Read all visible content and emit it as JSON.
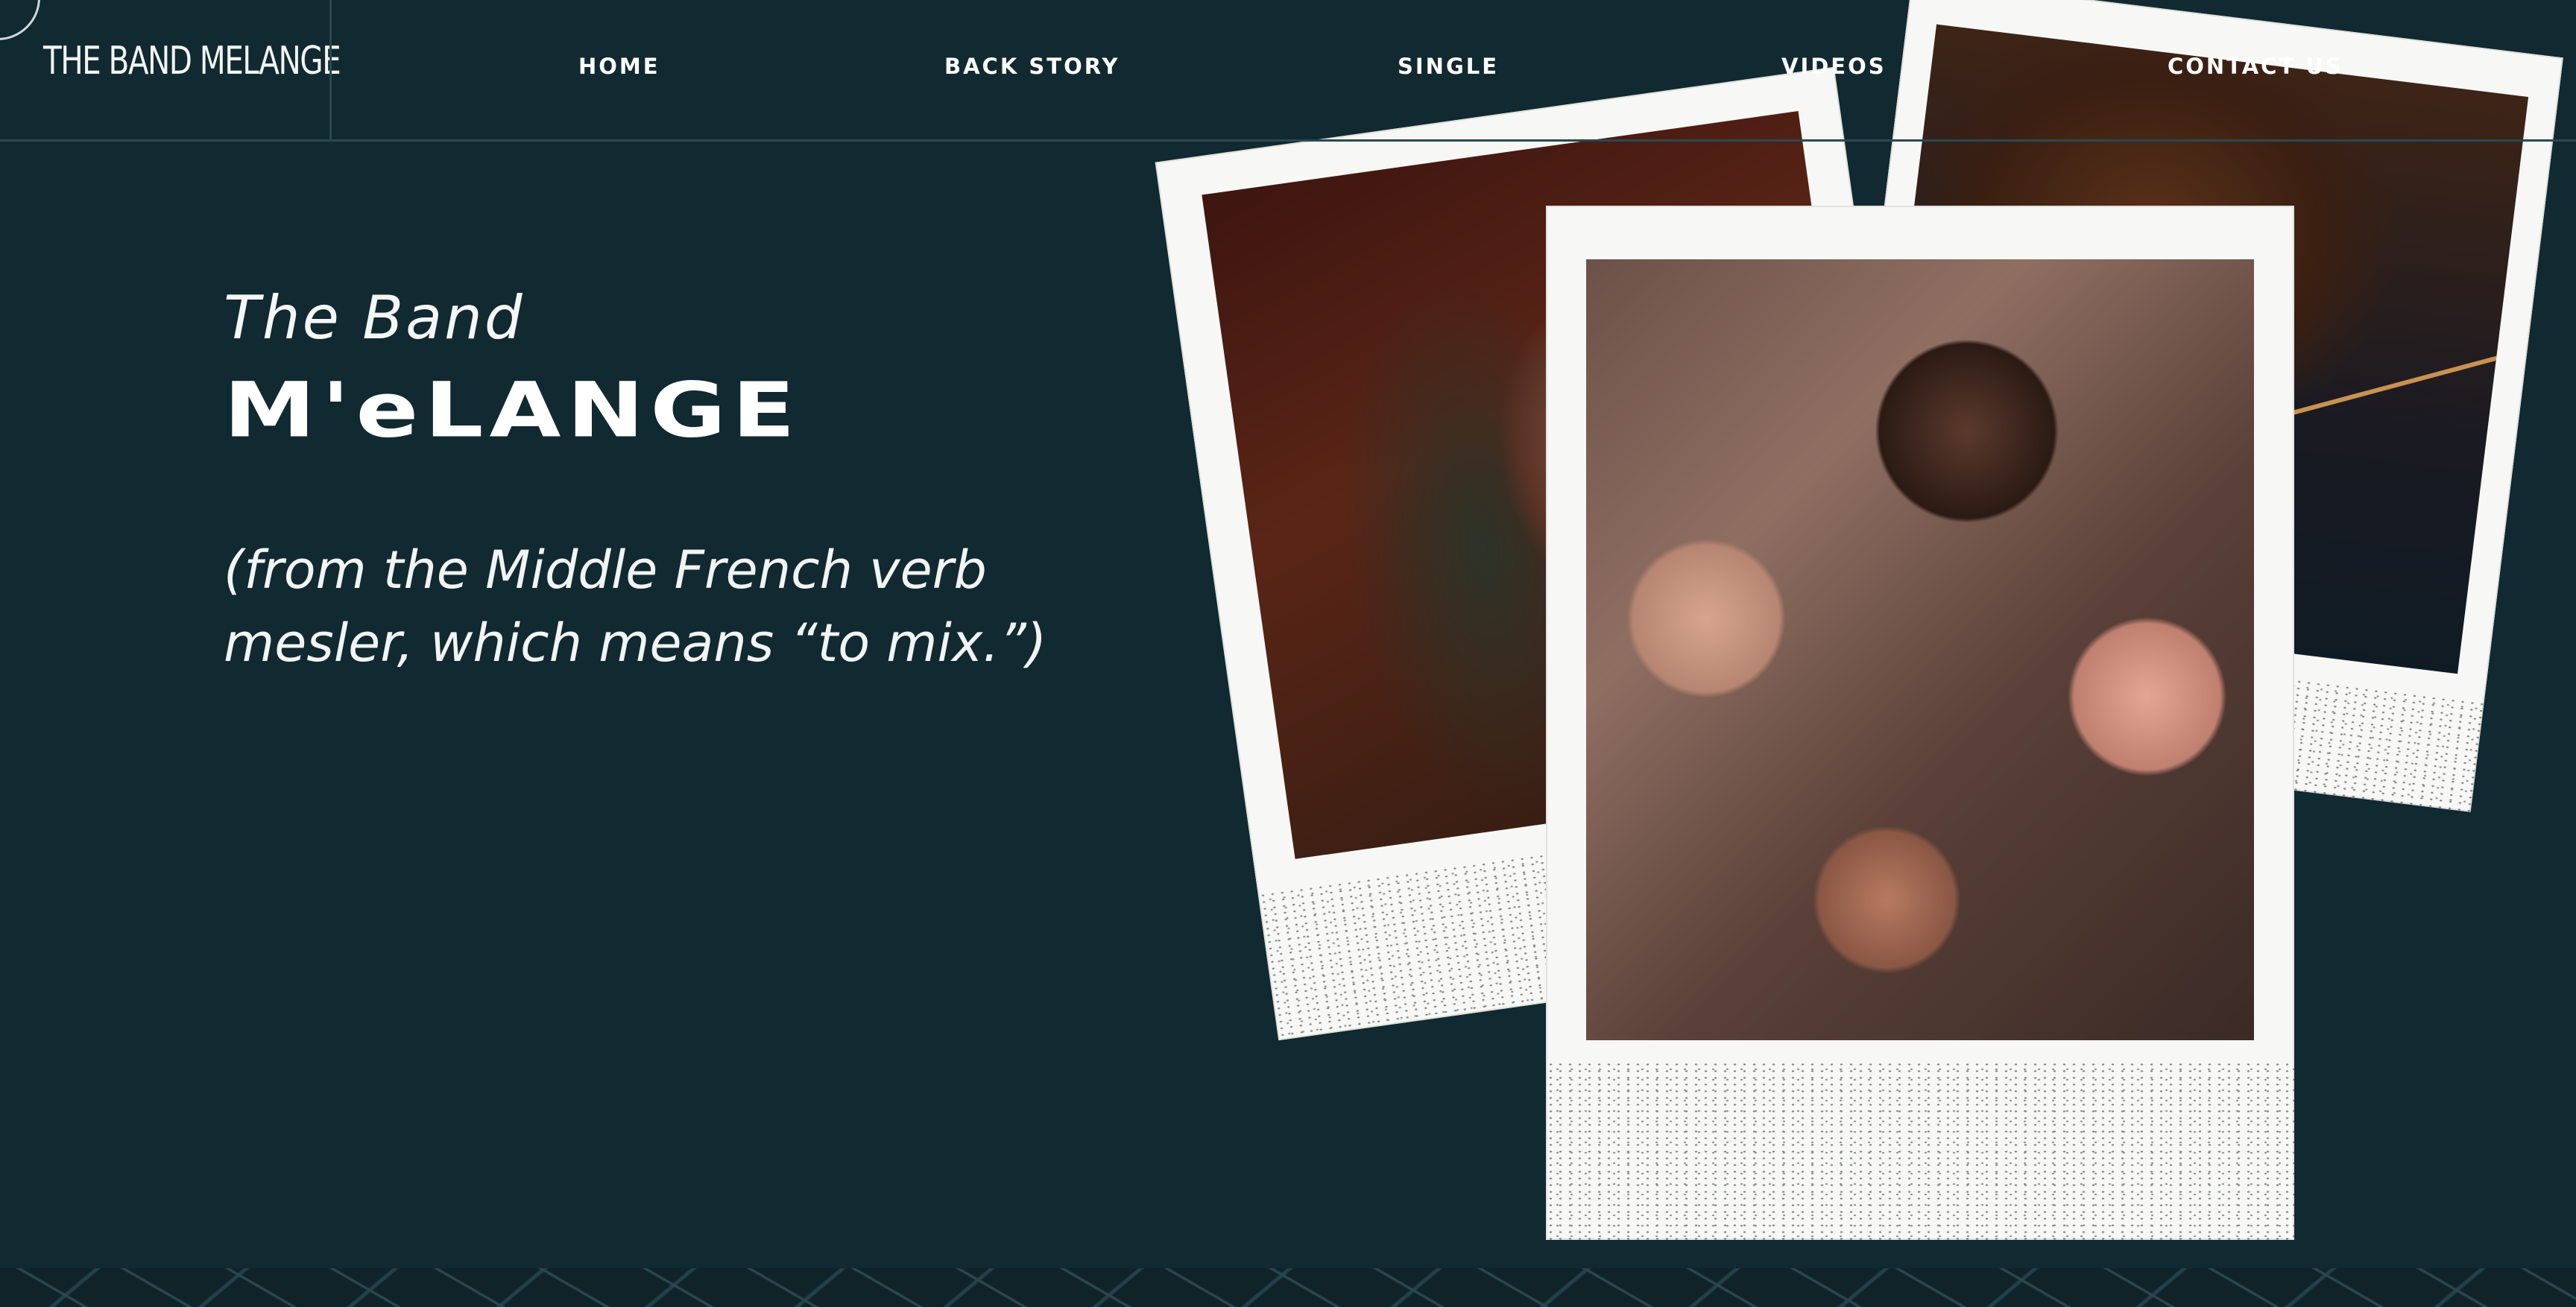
{
  "site": {
    "logo": "THE BAND MELANGE"
  },
  "nav": {
    "items": [
      {
        "label": "HOME"
      },
      {
        "label": "BACK STORY"
      },
      {
        "label": "SINGLE"
      },
      {
        "label": "VIDEOS"
      },
      {
        "label": "CONTACT US"
      }
    ]
  },
  "hero": {
    "prefix": "The Band",
    "title": "M'eLANGE",
    "subtitle": "(from the Middle French verb mesler, which means “to mix.”)"
  },
  "colors": {
    "background": "#112930",
    "text": "#ffffff",
    "polaroid_frame": "#f7f7f5"
  }
}
